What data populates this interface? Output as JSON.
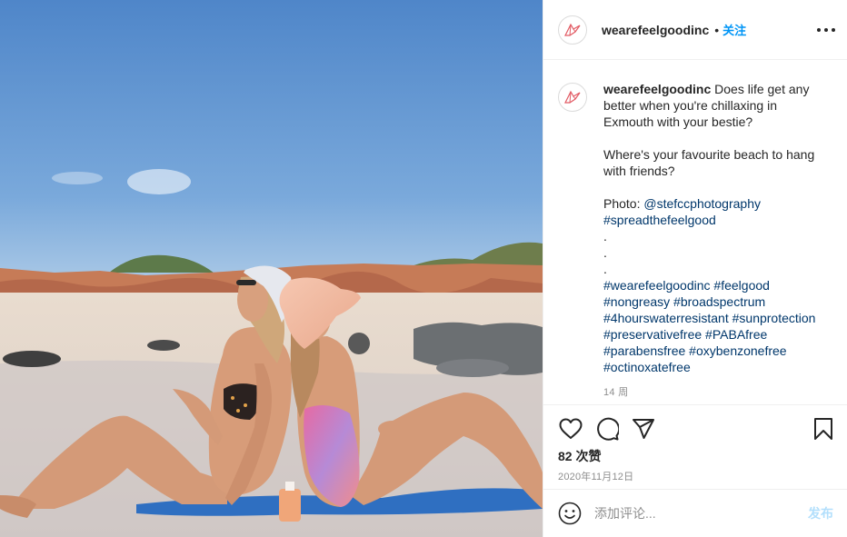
{
  "post": {
    "username": "wearefeelgoodinc",
    "follow_label": "关注",
    "dot": "•",
    "caption": {
      "username": "wearefeelgoodinc",
      "intro": "Does life get any better when you're chillaxing in Exmouth with your bestie?",
      "question": "Where's your favourite beach to hang with friends?",
      "photo_label": "Photo: ",
      "photo_credit": "@stefccphotography",
      "tag_main": "#spreadthefeelgood",
      "dots": ".\n.\n.",
      "hashtags": "#wearefeelgoodinc #feelgood #nongreasy #broadspectrum #4hourswaterresistant #sunprotection #preservativefree #PABAfree #parabensfree #oxybenzonefree #octinoxatefree"
    },
    "time_ago": "14 周",
    "likes": "82 次赞",
    "date": "2020年11月12日",
    "comment_placeholder": "添加评论...",
    "post_button": "发布"
  },
  "icons": {
    "avatar": "bird-logo-icon",
    "more": "more-options-icon",
    "like": "heart-icon",
    "comment": "comment-icon",
    "share": "share-icon",
    "save": "bookmark-icon",
    "emoji": "emoji-icon"
  },
  "colors": {
    "accent": "#0095f6",
    "link": "#00376b",
    "muted": "#8e8e8e",
    "post_disabled": "#b2dffc",
    "logo": "#e25b64"
  }
}
